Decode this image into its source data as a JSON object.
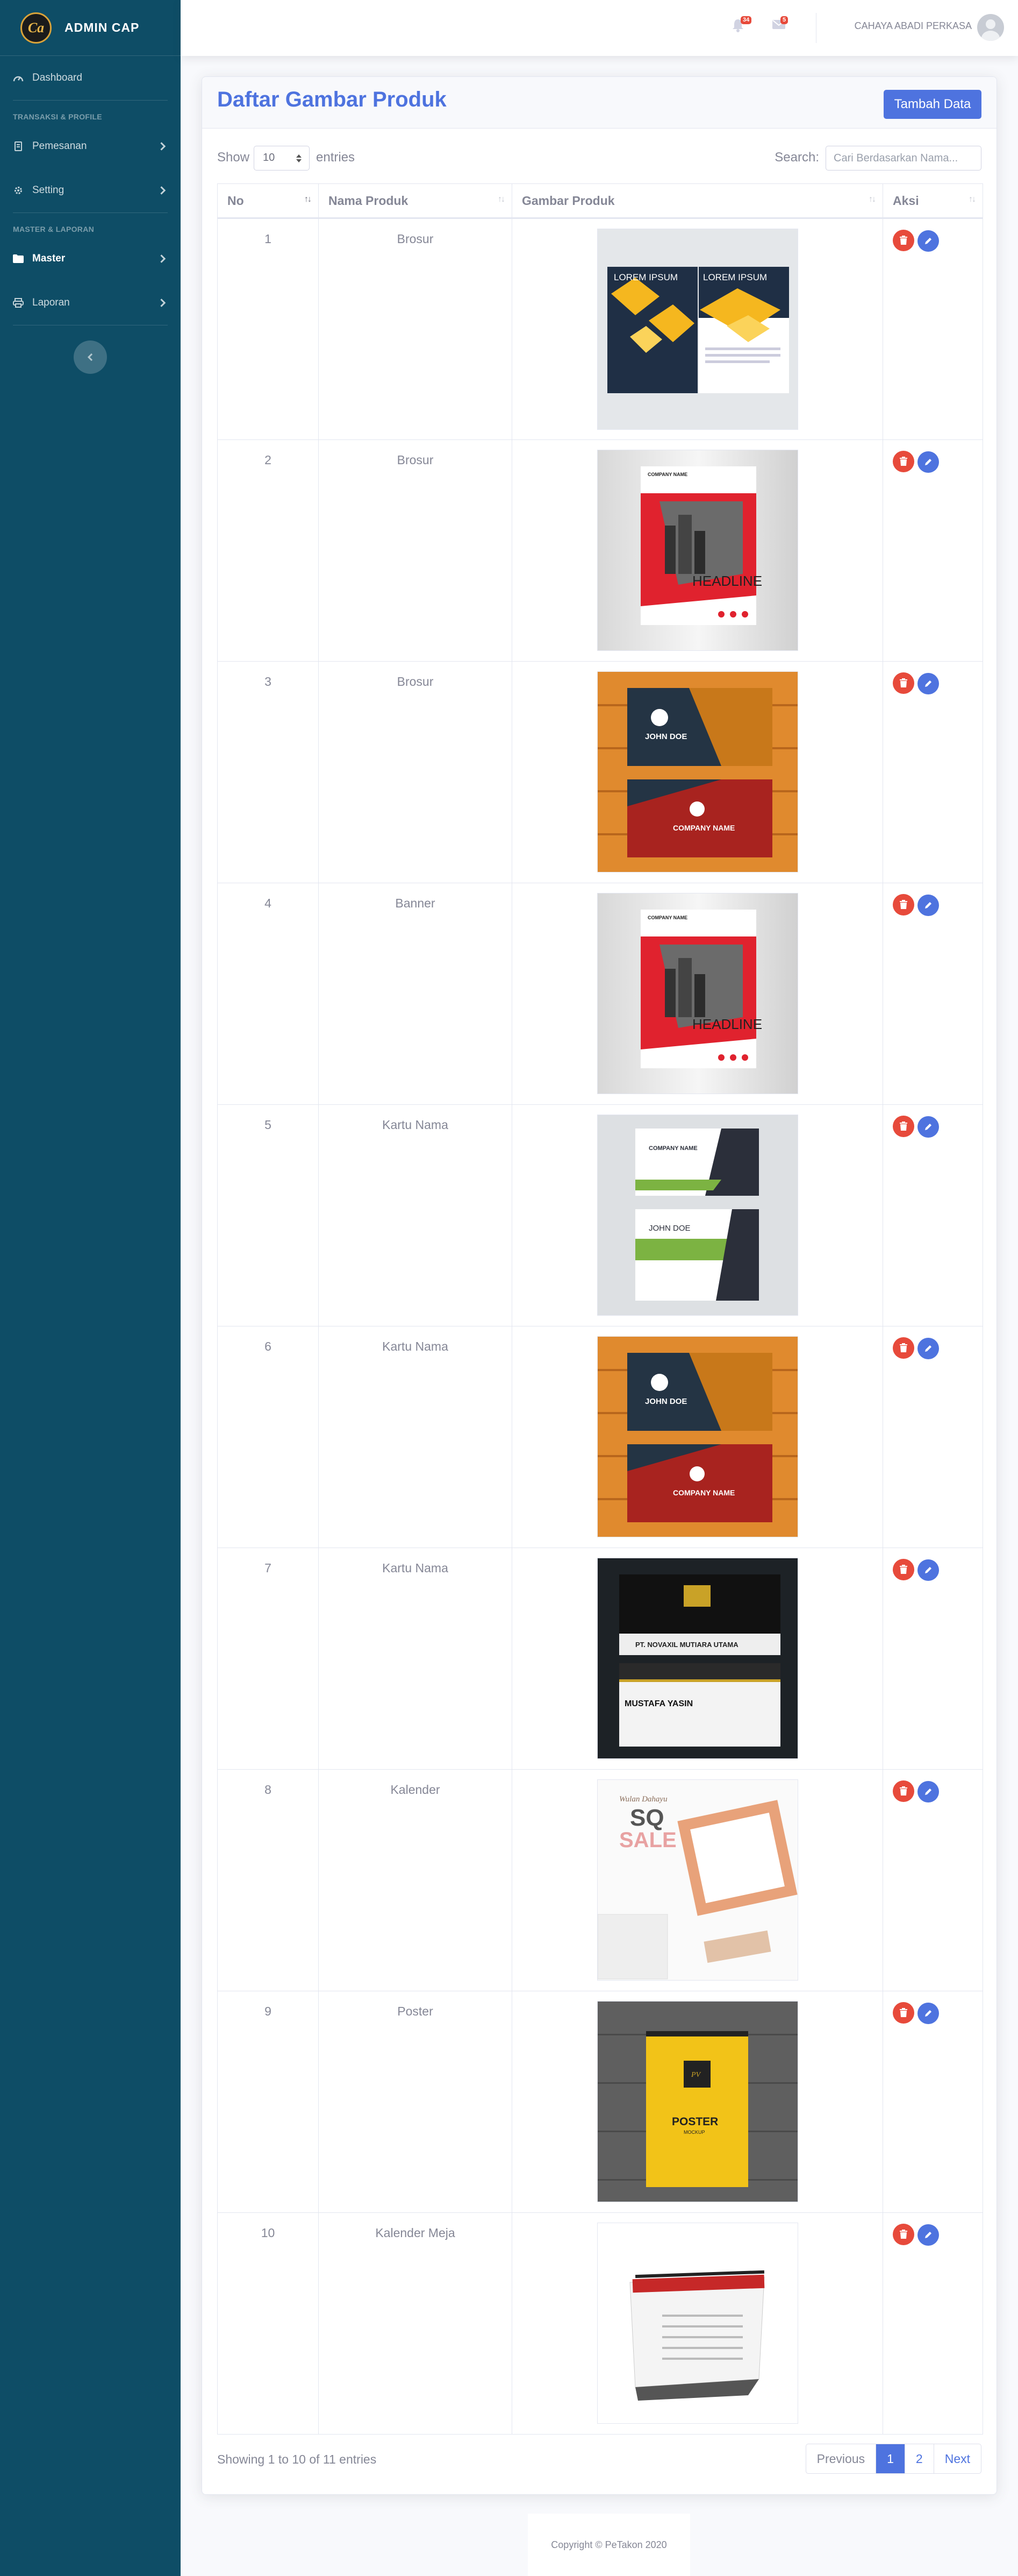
{
  "brand": {
    "name": "ADMIN CAP",
    "logo_text": "Ca"
  },
  "sidebar": {
    "items": [
      {
        "label": "Dashboard",
        "icon": "tachometer-icon"
      },
      {
        "label": "Pemesanan",
        "icon": "receipt-icon"
      },
      {
        "label": "Setting",
        "icon": "gear-icon"
      },
      {
        "label": "Master",
        "icon": "folder-icon"
      },
      {
        "label": "Laporan",
        "icon": "print-icon"
      }
    ],
    "headings": [
      "Transaksi & Profile",
      "Master & Laporan"
    ]
  },
  "topbar": {
    "alerts_count": "34",
    "messages_count": "5",
    "user_name": "CAHAYA ABADI PERKASA"
  },
  "page": {
    "title": "Daftar Gambar Produk",
    "add_button": "Tambah Data"
  },
  "table": {
    "show_label": "Show",
    "entries_value": "10",
    "entries_label": "entries",
    "search_label": "Search:",
    "search_placeholder": "Cari Berdasarkan Nama...",
    "columns": [
      "No",
      "Nama Produk",
      "Gambar Produk",
      "Aksi"
    ],
    "rows": [
      {
        "no": "1",
        "name": "Brosur",
        "image": "brochure-lorem-ipsum-image"
      },
      {
        "no": "2",
        "name": "Brosur",
        "image": "brochure-headline-image"
      },
      {
        "no": "3",
        "name": "Brosur",
        "image": "business-card-wood-image"
      },
      {
        "no": "4",
        "name": "Banner",
        "image": "brochure-headline-image"
      },
      {
        "no": "5",
        "name": "Kartu Nama",
        "image": "business-card-green-image"
      },
      {
        "no": "6",
        "name": "Kartu Nama",
        "image": "business-card-wood-image"
      },
      {
        "no": "7",
        "name": "Kartu Nama",
        "image": "business-card-black-image"
      },
      {
        "no": "8",
        "name": "Kalender",
        "image": "calendar-sale-image"
      },
      {
        "no": "9",
        "name": "Poster",
        "image": "poster-mockup-image"
      },
      {
        "no": "10",
        "name": "Kalender Meja",
        "image": "desk-calendar-image"
      }
    ],
    "info": "Showing 1 to 10 of 11 entries",
    "pagination": [
      "Previous",
      "1",
      "2",
      "Next"
    ]
  },
  "thumb_text": {
    "lorem": "LOREM IPSUM",
    "headline": "HEADLINE",
    "company": "COMPANY NAME",
    "john": "JOHN DOE",
    "pt": "PT. NOVAXIL MUTIARA UTAMA",
    "mustafa": "MUSTAFA YASIN",
    "sale": "SALE",
    "sq": "SQ",
    "wulan": "Wulan Dahayu",
    "poster": "POSTER",
    "mockup": "MOCKUP",
    "pv": "PV"
  },
  "colors": {
    "sidebar": "#0e4d66",
    "primary": "#4e73df",
    "danger": "#e74a3b"
  },
  "footer": {
    "copyright": "Copyright © PeTakon 2020"
  }
}
